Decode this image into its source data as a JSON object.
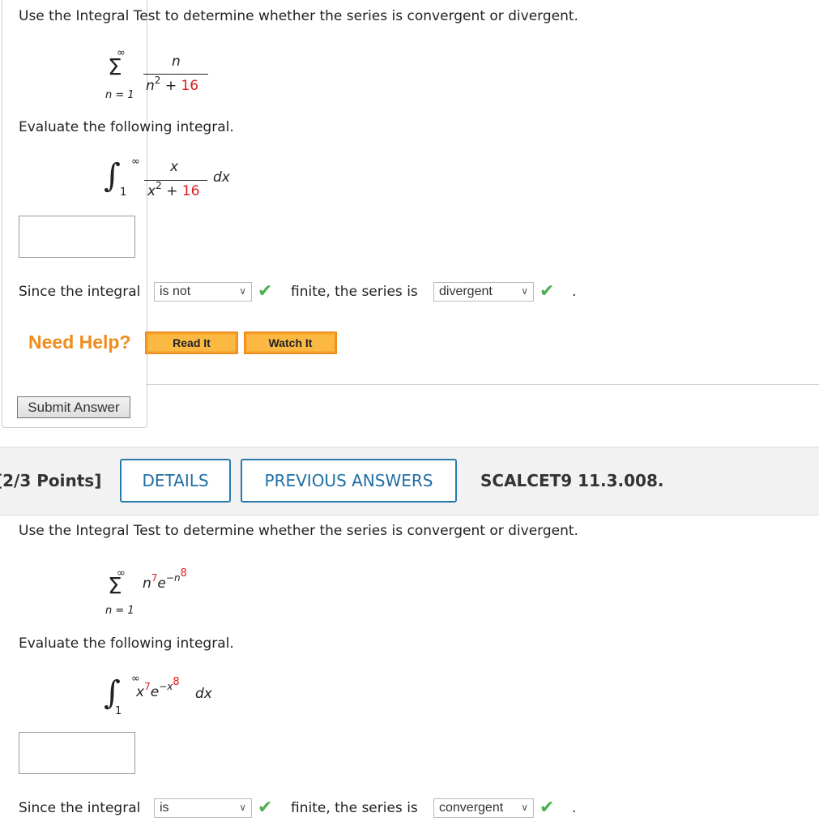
{
  "q1": {
    "prompt": "Use the Integral Test to determine whether the series is convergent or divergent.",
    "series": {
      "sigma": "Σ",
      "upper": "∞",
      "lower": "n = 1",
      "numerator": "n",
      "den_base": "n",
      "den_exp": "2",
      "den_plus": " + ",
      "den_const": "16"
    },
    "evaluate": "Evaluate the following integral.",
    "integral": {
      "sign": "∫",
      "upper": "∞",
      "lower": "1",
      "numerator": "x",
      "den_base": "x",
      "den_exp": "2",
      "den_plus": " + ",
      "den_const": "16",
      "dx": "dx"
    },
    "answer_value": "",
    "since_text": "Since the integral",
    "select1": "is not",
    "finite_text": "finite, the series is",
    "select2": "divergent",
    "period": ".",
    "need_help": "Need Help?",
    "read_it": "Read It",
    "watch_it": "Watch It",
    "submit": "Submit Answer"
  },
  "q2": {
    "points": "[2/3 Points]",
    "details": "DETAILS",
    "previous_answers": "PREVIOUS ANSWERS",
    "code": "SCALCET9 11.3.008.",
    "prompt": "Use the Integral Test to determine whether the series is convergent or divergent.",
    "series": {
      "sigma": "Σ",
      "upper": "∞",
      "lower": "n = 1",
      "base": "n",
      "exp1": "7",
      "e": "e",
      "neg": "−n",
      "exp2": "8"
    },
    "evaluate": "Evaluate the following integral.",
    "integral": {
      "sign": "∫",
      "upper": "∞",
      "lower": "1",
      "base": "x",
      "exp1": "7",
      "e": "e",
      "neg": "−x",
      "exp2": "8",
      "dx": "dx"
    },
    "answer_value": "",
    "since_text": "Since the integral",
    "select1": "is",
    "finite_text": "finite, the series is",
    "select2": "convergent",
    "period": "."
  },
  "colors": {
    "accent": "#1f6ea3",
    "help": "#ef8c1b",
    "check": "#4caf50",
    "red": "#e0191b"
  }
}
